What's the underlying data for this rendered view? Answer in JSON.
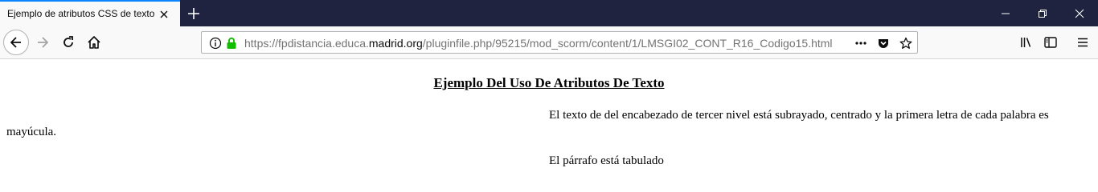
{
  "tab": {
    "title": "Ejemplo de atributos CSS de texto"
  },
  "address_bar": {
    "url_prefix": "https://fpdistancia.educa.",
    "url_host": "madrid.org",
    "url_suffix": "/pluginfile.php/95215/mod_scorm/content/1/LMSGI02_CONT_R16_Codigo15.html"
  },
  "page": {
    "heading": "Ejemplo Del Uso De Atributos De Texto",
    "paragraphs": [
      "El texto de del encabezado de tercer nivel está subrayado, centrado y la primera letra de cada palabra es mayúcula.",
      "El párrafo está tabulado"
    ]
  },
  "colors": {
    "tabstrip": "#202340",
    "active_tab_accent": "#0a84ff",
    "secure_lock": "#12bc00"
  }
}
